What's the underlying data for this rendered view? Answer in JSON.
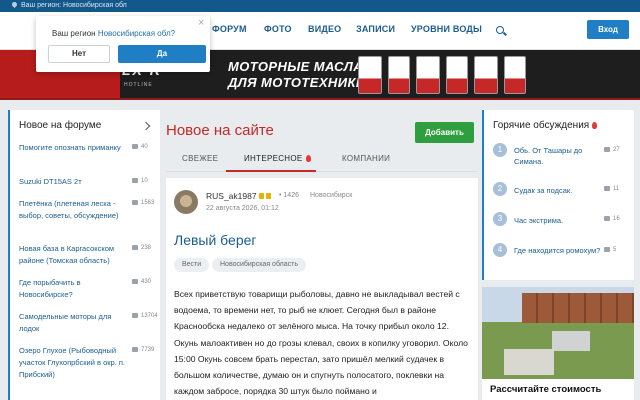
{
  "topbar": {
    "region_text": "Ваш регион: Новосибирская обл"
  },
  "popup": {
    "question": "Ваш регион",
    "region": "Новосибирская обл?",
    "no": "Нет",
    "yes": "Да",
    "close": "×"
  },
  "nav": {
    "items": [
      "ФОРУМ",
      "ФОТО",
      "ВИДЕО",
      "ЗАПИСИ",
      "УРОВНИ ВОДЫ"
    ],
    "login": "Вход"
  },
  "banner": {
    "brand": "LX R",
    "hotline": "HOTLINE",
    "slogan_1": "МОТОРНЫЕ МАСЛА",
    "slogan_2": "ДЛЯ МОТОТЕХНИКИ"
  },
  "left": {
    "title": "Новое на форуме",
    "items": [
      {
        "title": "Помогите опознать приманку",
        "count": "40"
      },
      {
        "title": "Suzuki DT15AS 2т",
        "count": "10"
      },
      {
        "title": "Плетёнка (плетеная леска - выбор, советы, обсуждение)",
        "count": "1563"
      },
      {
        "title": "Новая база в Каргасокском районе (Томская область)",
        "count": "238"
      },
      {
        "title": "Где порыбачить в Новосибирске?",
        "count": "430"
      },
      {
        "title": "Самодельные моторы для лодок",
        "count": "13704"
      },
      {
        "title": "Озеро Глухое (Рыбоводный участок Глухопрбский в окр. п. Прибский)",
        "count": "7739"
      }
    ]
  },
  "center": {
    "title": "Новое на сайте",
    "add_button": "Добавить",
    "tabs": [
      "СВЕЖЕЕ",
      "ИНТЕРЕСНОЕ",
      "КОМПАНИИ"
    ],
    "post": {
      "author": "RUS_ak1987",
      "rating": "1426",
      "city": "Новосибирск",
      "date": "22 августа 2026, 01:12",
      "title": "Левый берег",
      "tags": [
        "Вести",
        "Новосибирская область"
      ],
      "body": "Всех приветствую товарищи рыболовы, давно не выкладывал вестей с водоема, то времени нет, то рыб не клюет. Сегодня был в районе Краснообска недалеко от зелёного мыса. На точку прибыл около 12. Окунь малоактивен но до грозы клевал, своих в копилку уговорил. Около 15:00 Окунь совсем брать перестал, зато пришёл мелкий судачек в большом количестве, думаю он и спугнуть полосатого, поклевки на каждом забросе, порядка 30 штук было поймано и"
    }
  },
  "right": {
    "title": "Горячие обсуждения",
    "items": [
      {
        "num": "1",
        "title": "Обь. От Ташары до Симана.",
        "count": "27"
      },
      {
        "num": "2",
        "title": "Судак за подсак.",
        "count": "11"
      },
      {
        "num": "3",
        "title": "Час экстрима.",
        "count": "16"
      },
      {
        "num": "4",
        "title": "Где находится ромохум?",
        "count": "5"
      }
    ],
    "ad_caption": "Рассчитайте стоимость"
  }
}
